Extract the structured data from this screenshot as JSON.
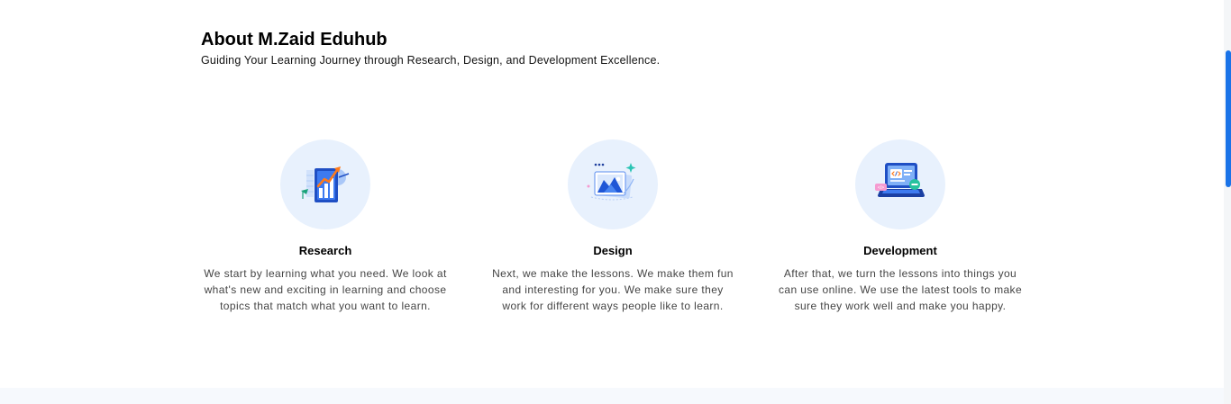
{
  "about": {
    "title": "About M.Zaid Eduhub",
    "subtitle": "Guiding Your Learning Journey through Research, Design, and Development Excellence."
  },
  "cards": [
    {
      "icon": "research-chart-icon",
      "title": "Research",
      "description": "We start by learning what you need. We look at what's new and exciting in learning and choose topics that match what you want to learn."
    },
    {
      "icon": "design-image-icon",
      "title": "Design",
      "description": "Next, we make the lessons. We make them fun and interesting for you. We make sure they work for different ways people like to learn."
    },
    {
      "icon": "development-laptop-code-icon",
      "title": "Development",
      "description": "After that, we turn the lessons into things you can use online. We use the latest tools to make sure they work well and make you happy."
    }
  ],
  "colors": {
    "icon_circle_bg": "#e8f1fd",
    "accent_blue": "#1a73e8",
    "footer_band": "#f6f9fd"
  }
}
